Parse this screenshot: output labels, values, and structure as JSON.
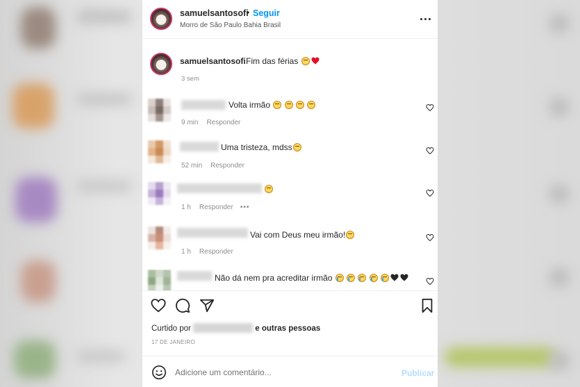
{
  "post": {
    "username": "samuelsantosofi",
    "dot": "•",
    "follow_label": "Seguir",
    "location": "Morro de São Paulo Bahia Brasil"
  },
  "caption": {
    "username": "samuelsantosofi",
    "text": "Fim das férias",
    "time": "3 sem"
  },
  "comments": [
    {
      "text": "Volta irmão",
      "time": "9 min",
      "reply": "Responder",
      "emoji": [
        "grin",
        "grin",
        "grin",
        "grin"
      ]
    },
    {
      "text": "Uma tristeza, mdss",
      "time": "52 min",
      "reply": "Responder",
      "emoji": [
        "grin"
      ]
    },
    {
      "text": "",
      "time": "1 h",
      "reply": "Responder",
      "more": "•••",
      "emoji": [
        "grin"
      ]
    },
    {
      "text": "Vai com Deus meu irmão!",
      "time": "1 h",
      "reply": "Responder",
      "emoji": [
        "grin"
      ]
    },
    {
      "text": "Não dá nem pra acreditar irmão",
      "time": "",
      "reply": "",
      "emoji": [
        "cry",
        "cry",
        "cry",
        "cry",
        "cry",
        "black-heart",
        "black-heart"
      ]
    }
  ],
  "actions": {
    "liked_by_prefix": "Curtido por",
    "liked_by_suffix": "e outras pessoas",
    "date": "17 DE JANEIRO"
  },
  "add_comment": {
    "placeholder": "Adicione um comentário...",
    "publish_label": "Publicar"
  },
  "colors": {
    "accent": "#0095f6",
    "publish_disabled": "#b3dbff",
    "meta_text": "#8e8e8e"
  }
}
